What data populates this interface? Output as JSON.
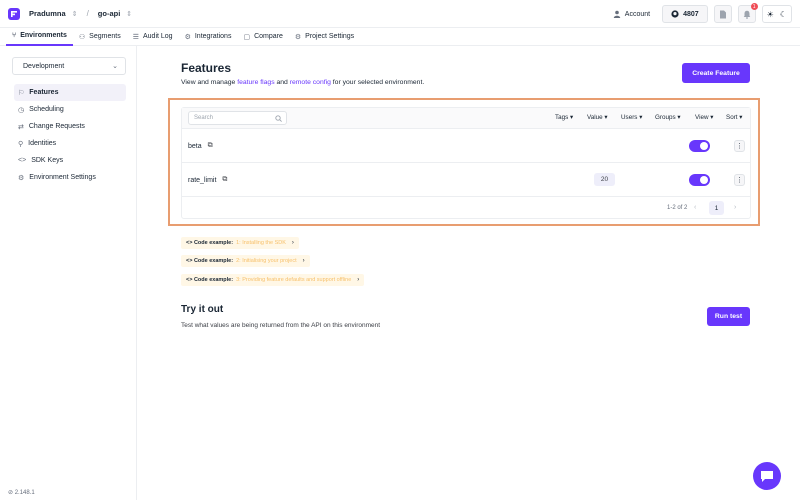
{
  "topbar": {
    "org": "Pradumna",
    "project": "go-api",
    "account_label": "Account",
    "github_count": "4807",
    "notification_count": "1",
    "icons": {
      "logo": "flagsmith-logo",
      "account": "user-icon",
      "github": "github-icon",
      "docs": "document-icon",
      "bell": "bell-icon",
      "sun": "sun-icon",
      "moon": "moon-icon"
    }
  },
  "tabs": [
    {
      "label": "Environments",
      "icon": "branch-icon",
      "active": true
    },
    {
      "label": "Segments",
      "icon": "segments-icon"
    },
    {
      "label": "Audit Log",
      "icon": "list-icon"
    },
    {
      "label": "Integrations",
      "icon": "integrations-icon"
    },
    {
      "label": "Compare",
      "icon": "compare-icon"
    },
    {
      "label": "Project Settings",
      "icon": "gear-icon"
    }
  ],
  "sidebar": {
    "environment": "Development",
    "items": [
      {
        "label": "Features",
        "icon": "features-icon",
        "active": true
      },
      {
        "label": "Scheduling",
        "icon": "clock-icon"
      },
      {
        "label": "Change Requests",
        "icon": "change-request-icon"
      },
      {
        "label": "Identities",
        "icon": "user-icon"
      },
      {
        "label": "SDK Keys",
        "icon": "code-icon"
      },
      {
        "label": "Environment Settings",
        "icon": "gear-icon"
      }
    ],
    "version": "2.148.1"
  },
  "main": {
    "title": "Features",
    "desc_prefix": "View and manage ",
    "desc_link1": "feature flags",
    "desc_and": " and ",
    "desc_link2": "remote config",
    "desc_suffix": " for your selected environment.",
    "create_label": "Create Feature",
    "search_placeholder": "Search",
    "filters": {
      "tags": "Tags",
      "value": "Value",
      "users": "Users",
      "groups": "Groups",
      "view": "View",
      "sort": "Sort"
    },
    "features": [
      {
        "name": "beta",
        "value": "",
        "enabled": true
      },
      {
        "name": "rate_limit",
        "value": "20",
        "enabled": true
      }
    ],
    "pagination": {
      "info": "1-2 of 2",
      "page": "1"
    },
    "code_examples": [
      {
        "label": "<> Code example:",
        "title": "1: Installing the SDK"
      },
      {
        "label": "<> Code example:",
        "title": "2: Initialising your project"
      },
      {
        "label": "<> Code example:",
        "title": "3: Providing feature defaults and support offline"
      }
    ],
    "try_title": "Try it out",
    "try_desc": "Test what values are being returned from the API on this environment",
    "run_label": "Run test"
  },
  "colors": {
    "accent": "#6837fc",
    "highlight": "#e89d70",
    "code_title": "#f7c06b"
  }
}
